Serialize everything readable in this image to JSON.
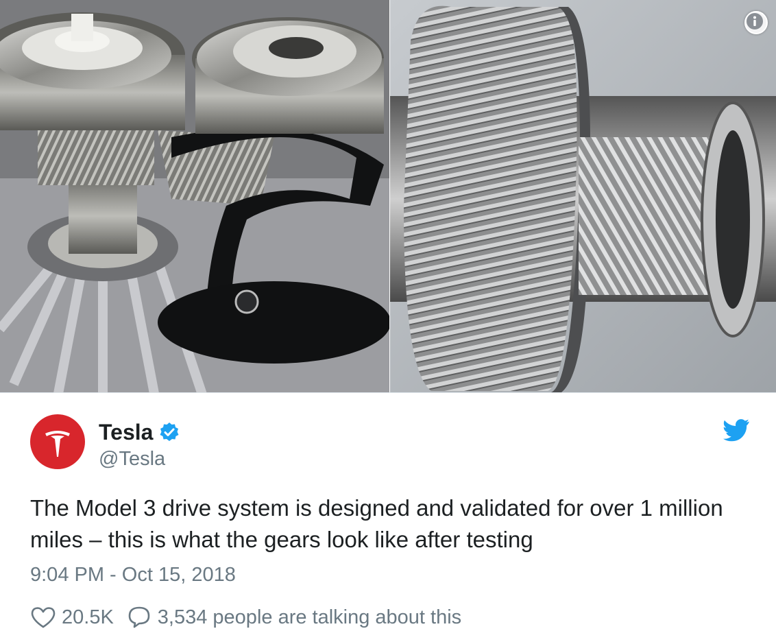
{
  "media": {
    "left_photo_icon": "gears-bearings-photo",
    "right_photo_icon": "gear-shaft-photo",
    "info_icon": "info-icon"
  },
  "author": {
    "display_name": "Tesla",
    "handle": "@Tesla",
    "verified": true,
    "avatar_icon": "tesla-logo-icon",
    "avatar_color": "#d8262c"
  },
  "tweet": {
    "text": "The Model 3 drive system is designed and validated for over 1 million miles – this is what the gears look like after testing",
    "timestamp": "9:04 PM - Oct 15, 2018"
  },
  "actions": {
    "likes": "20.5K",
    "talking": "3,534 people are talking about this"
  },
  "colors": {
    "twitter_blue": "#1da1f2",
    "muted_text": "#697882",
    "text": "#1c2022"
  }
}
